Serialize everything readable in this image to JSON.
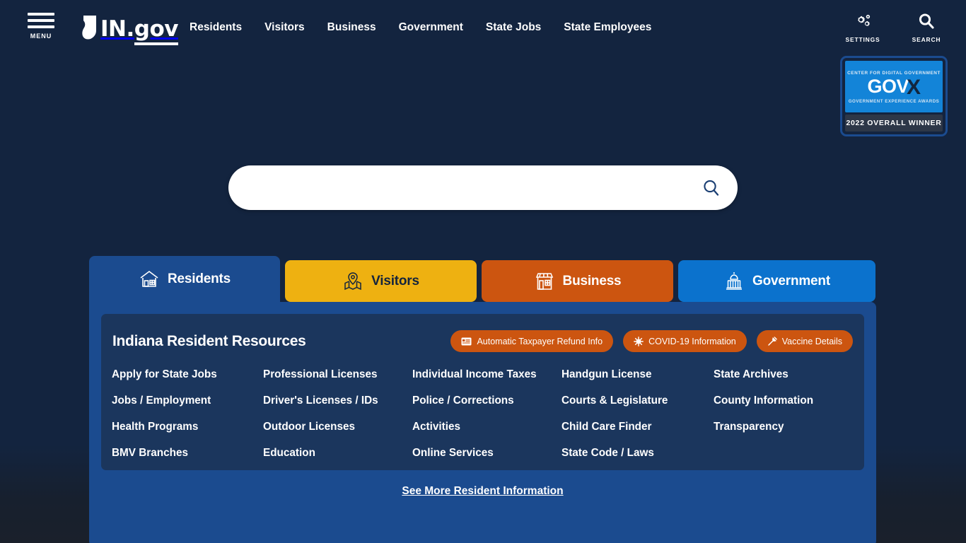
{
  "header": {
    "menu_label": "MENU",
    "logo_text": "IN.gov",
    "logo_icon": "indiana-state-shape",
    "nav": [
      {
        "label": "Residents"
      },
      {
        "label": "Visitors"
      },
      {
        "label": "Business"
      },
      {
        "label": "Government"
      },
      {
        "label": "State Jobs"
      },
      {
        "label": "State Employees"
      }
    ],
    "tools": [
      {
        "label": "SETTINGS",
        "icon": "gears-icon"
      },
      {
        "label": "SEARCH",
        "icon": "search-icon"
      }
    ]
  },
  "badge": {
    "line1": "CENTER FOR DIGITAL GOVERNMENT",
    "main": "GOV",
    "main_x": "X",
    "line2": "GOVERNMENT EXPERIENCE AWARDS",
    "line3": "2022 OVERALL WINNER"
  },
  "search": {
    "value": "",
    "placeholder": "",
    "icon": "search-icon"
  },
  "tabs": [
    {
      "label": "Residents",
      "icon": "house-icon",
      "active": true,
      "color": "#1b4b8f"
    },
    {
      "label": "Visitors",
      "icon": "map-pin-icon",
      "active": false,
      "color": "#eeb111"
    },
    {
      "label": "Business",
      "icon": "storefront-icon",
      "active": false,
      "color": "#cc5510"
    },
    {
      "label": "Government",
      "icon": "capitol-icon",
      "active": false,
      "color": "#0b72cd"
    }
  ],
  "panel": {
    "title": "Indiana Resident Resources",
    "pills": [
      {
        "label": "Automatic Taxpayer Refund Info",
        "icon": "id-card-icon"
      },
      {
        "label": "COVID-19 Information",
        "icon": "virus-icon"
      },
      {
        "label": "Vaccine Details",
        "icon": "syringe-icon"
      }
    ],
    "columns": [
      [
        "Apply for State Jobs",
        "Jobs / Employment",
        "Health Programs",
        "BMV Branches"
      ],
      [
        "Professional Licenses",
        "Driver's Licenses / IDs",
        "Outdoor Licenses",
        "Education"
      ],
      [
        "Individual Income Taxes",
        "Police / Corrections",
        "Activities",
        "Online Services"
      ],
      [
        "Handgun License",
        "Courts & Legislature",
        "Child Care Finder",
        "State Code / Laws"
      ],
      [
        "State Archives",
        "County Information",
        "Transparency"
      ]
    ],
    "see_more": "See More Resident Information"
  },
  "colors": {
    "page_bg": "#13243f",
    "panel_outer": "#1b4b8f",
    "panel_inner": "#1b365d",
    "accent_gold": "#eeb111",
    "accent_orange": "#cc5510",
    "accent_blue": "#0b72cd"
  }
}
